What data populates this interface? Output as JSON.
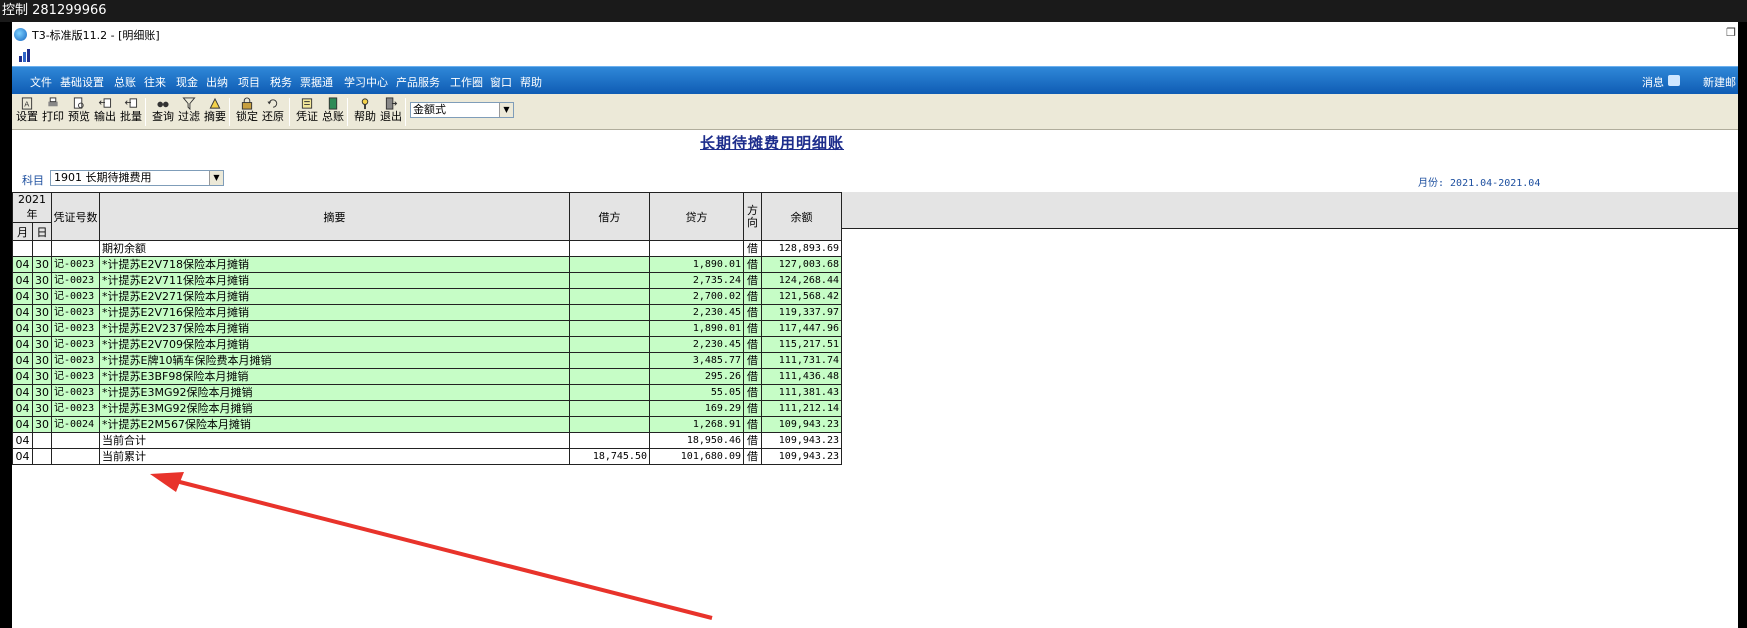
{
  "remote_title": "控制 281299966",
  "window": {
    "title": "T3-标准版11.2 - [明细账]",
    "collapse_glyph": "﹀",
    "restore_glyph": "❐"
  },
  "menu": {
    "items": [
      "文件",
      "基础设置",
      "总账",
      "往来",
      "现金",
      "出纳",
      "项目",
      "税务",
      "票据通",
      "学习中心",
      "产品服务",
      "工作圈",
      "窗口",
      "帮助"
    ],
    "messages": "消息",
    "new_link": "新建邮"
  },
  "toolbar": {
    "buttons": [
      {
        "label": "设置",
        "icon": "settings-icon"
      },
      {
        "label": "打印",
        "icon": "printer-icon"
      },
      {
        "label": "预览",
        "icon": "preview-icon"
      },
      {
        "label": "输出",
        "icon": "export-icon"
      },
      {
        "label": "批量",
        "icon": "batch-icon"
      },
      {
        "label": "查询",
        "icon": "binoculars-icon"
      },
      {
        "label": "过滤",
        "icon": "filter-icon"
      },
      {
        "label": "摘要",
        "icon": "summary-icon"
      },
      {
        "label": "锁定",
        "icon": "lock-icon"
      },
      {
        "label": "还原",
        "icon": "restore-icon"
      },
      {
        "label": "凭证",
        "icon": "voucher-icon"
      },
      {
        "label": "总账",
        "icon": "ledger-icon"
      },
      {
        "label": "帮助",
        "icon": "help-icon"
      },
      {
        "label": "退出",
        "icon": "exit-icon"
      }
    ],
    "format_value": "金额式"
  },
  "report": {
    "title": "长期待摊费用明细账",
    "subject_label": "科目",
    "subject_value": "1901 长期待摊费用",
    "period": "月份: 2021.04-2021.04"
  },
  "table": {
    "headers": {
      "year": "2021年",
      "month": "月",
      "day": "日",
      "voucher": "凭证号数",
      "summary": "摘要",
      "debit": "借方",
      "credit": "贷方",
      "direction": "方向",
      "balance": "余额"
    },
    "rows": [
      {
        "m": "",
        "d": "",
        "voucher": "",
        "summary": "期初余额",
        "debit": "",
        "credit": "",
        "dir": "借",
        "balance": "128,893.69",
        "green": false
      },
      {
        "m": "04",
        "d": "30",
        "voucher": "记-0023",
        "summary": "*计提苏E2V718保险本月摊销",
        "debit": "",
        "credit": "1,890.01",
        "dir": "借",
        "balance": "127,003.68",
        "green": true
      },
      {
        "m": "04",
        "d": "30",
        "voucher": "记-0023",
        "summary": "*计提苏E2V711保险本月摊销",
        "debit": "",
        "credit": "2,735.24",
        "dir": "借",
        "balance": "124,268.44",
        "green": true
      },
      {
        "m": "04",
        "d": "30",
        "voucher": "记-0023",
        "summary": "*计提苏E2V271保险本月摊销",
        "debit": "",
        "credit": "2,700.02",
        "dir": "借",
        "balance": "121,568.42",
        "green": true
      },
      {
        "m": "04",
        "d": "30",
        "voucher": "记-0023",
        "summary": "*计提苏E2V716保险本月摊销",
        "debit": "",
        "credit": "2,230.45",
        "dir": "借",
        "balance": "119,337.97",
        "green": true
      },
      {
        "m": "04",
        "d": "30",
        "voucher": "记-0023",
        "summary": "*计提苏E2V237保险本月摊销",
        "debit": "",
        "credit": "1,890.01",
        "dir": "借",
        "balance": "117,447.96",
        "green": true
      },
      {
        "m": "04",
        "d": "30",
        "voucher": "记-0023",
        "summary": "*计提苏E2V709保险本月摊销",
        "debit": "",
        "credit": "2,230.45",
        "dir": "借",
        "balance": "115,217.51",
        "green": true
      },
      {
        "m": "04",
        "d": "30",
        "voucher": "记-0023",
        "summary": "*计提苏E牌10辆车保险费本月摊销",
        "debit": "",
        "credit": "3,485.77",
        "dir": "借",
        "balance": "111,731.74",
        "green": true
      },
      {
        "m": "04",
        "d": "30",
        "voucher": "记-0023",
        "summary": "*计提苏E3BF98保险本月摊销",
        "debit": "",
        "credit": "295.26",
        "dir": "借",
        "balance": "111,436.48",
        "green": true
      },
      {
        "m": "04",
        "d": "30",
        "voucher": "记-0023",
        "summary": "*计提苏E3MG92保险本月摊销",
        "debit": "",
        "credit": "55.05",
        "dir": "借",
        "balance": "111,381.43",
        "green": true
      },
      {
        "m": "04",
        "d": "30",
        "voucher": "记-0023",
        "summary": "*计提苏E3MG92保险本月摊销",
        "debit": "",
        "credit": "169.29",
        "dir": "借",
        "balance": "111,212.14",
        "green": true
      },
      {
        "m": "04",
        "d": "30",
        "voucher": "记-0024",
        "summary": "*计提苏E2M567保险本月摊销",
        "debit": "",
        "credit": "1,268.91",
        "dir": "借",
        "balance": "109,943.23",
        "green": true
      },
      {
        "m": "04",
        "d": "",
        "voucher": "",
        "summary": "当前合计",
        "debit": "",
        "credit": "18,950.46",
        "dir": "借",
        "balance": "109,943.23",
        "green": false
      },
      {
        "m": "04",
        "d": "",
        "voucher": "",
        "summary": "当前累计",
        "debit": "18,745.50",
        "credit": "101,680.09",
        "dir": "借",
        "balance": "109,943.23",
        "green": false
      }
    ]
  },
  "colors": {
    "menu_blue": "#1a6fc8",
    "row_green": "#c6fdc6",
    "annotation_red": "#e8332b",
    "title_navy": "#1d2d8c"
  }
}
